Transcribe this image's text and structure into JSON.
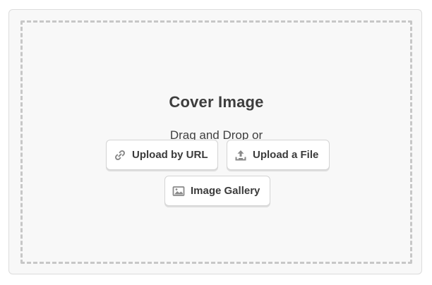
{
  "uploader": {
    "title": "Cover Image",
    "hint": "Drag and Drop or",
    "buttons": {
      "upload_by_url": {
        "label": "Upload by URL",
        "icon": "link-icon"
      },
      "upload_file": {
        "label": "Upload a File",
        "icon": "upload-icon"
      },
      "image_gallery": {
        "label": "Image Gallery",
        "icon": "image-icon"
      }
    }
  },
  "colors": {
    "background": "#f8f8f8",
    "border": "#dcdcdc",
    "dash": "#c7c7c7",
    "text": "#3d3d3d",
    "icon": "#8a8a8a"
  }
}
